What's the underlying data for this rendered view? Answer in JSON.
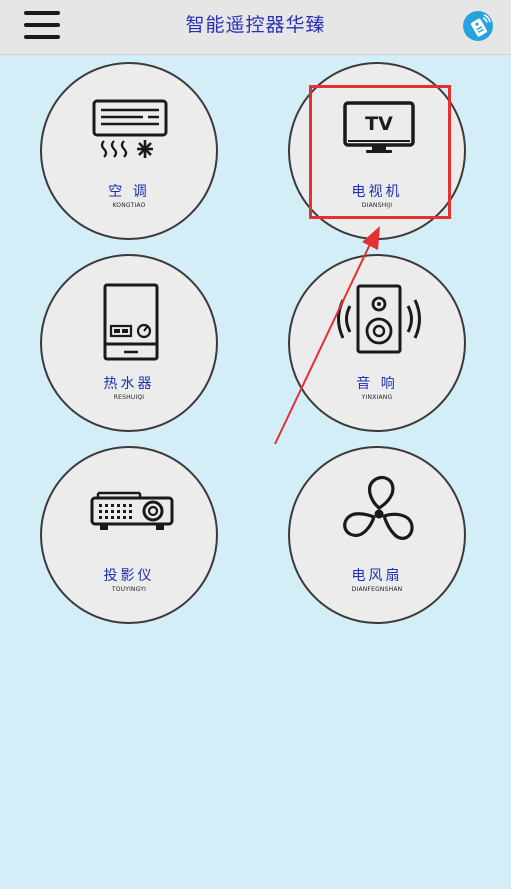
{
  "header": {
    "title": "智能遥控器华臻"
  },
  "devices": [
    {
      "label": "空 调",
      "sublabel": "KONGTIAO",
      "icon": "air-conditioner-icon"
    },
    {
      "label": "电视机",
      "sublabel": "DIANSHIJI",
      "icon": "tv-icon",
      "icon_text": "TV"
    },
    {
      "label": "热水器",
      "sublabel": "RESHUIQI",
      "icon": "water-heater-icon"
    },
    {
      "label": "音 响",
      "sublabel": "YINXIANG",
      "icon": "speaker-icon"
    },
    {
      "label": "投影仪",
      "sublabel": "TOUYINGYI",
      "icon": "projector-icon"
    },
    {
      "label": "电风扇",
      "sublabel": "DIANFEGNSHAN",
      "icon": "electric-fan-icon"
    }
  ],
  "colors": {
    "background": "#d4eef8",
    "title": "#2a2fb8",
    "label": "#1f2fb0",
    "annotation": "#e53030",
    "remote_icon": "#29a3e0"
  }
}
